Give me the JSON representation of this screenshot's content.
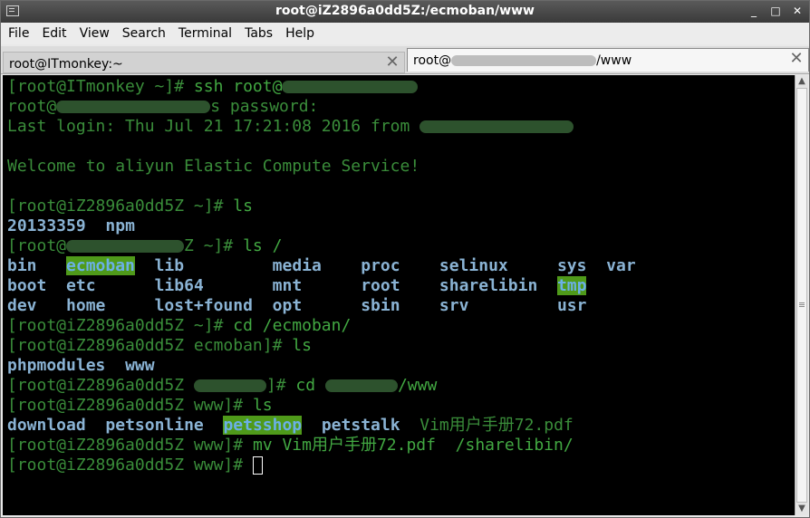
{
  "window": {
    "title": "root@iZ2896a0dd5Z:/ecmoban/www",
    "buttons": {
      "minimize": "_",
      "maximize": "□",
      "close": "✕"
    }
  },
  "menu": [
    "File",
    "Edit",
    "View",
    "Search",
    "Terminal",
    "Tabs",
    "Help"
  ],
  "tabs": [
    {
      "label": "root@ITmonkey:~",
      "close": "✕",
      "active": false
    },
    {
      "label_prefix": "root@",
      "label_suffix": "/www",
      "close": "✕",
      "active": true
    }
  ],
  "terminal": {
    "lines": {
      "l1_prompt": "[root@ITmonkey ~]# ",
      "l1_cmd": "ssh root@",
      "l2a": "root@",
      "l2b": "s password:",
      "l3": "Last login: Thu Jul 21 17:21:08 2016 from ",
      "l5": "Welcome to aliyun Elastic Compute Service!",
      "l7_prompt": "[root@iZ2896a0dd5Z ~]# ",
      "l7_cmd": "ls",
      "l8a": "20133359",
      "l8b": "npm",
      "l9a": "[root@",
      "l9b": "Z ~]# ",
      "l9_cmd": "ls /",
      "l13_prompt": "[root@iZ2896a0dd5Z ~]# ",
      "l13_cmd": "cd /ecmoban/",
      "l14_prompt": "[root@iZ2896a0dd5Z ecmoban]# ",
      "l14_cmd": "ls",
      "l15a": "phpmodules",
      "l15b": "www",
      "l16_prompt": "[root@iZ2896a0dd5Z ",
      "l16_mid": "]# ",
      "l16_cmd": "cd ",
      "l16_end": "/www",
      "l17_prompt": "[root@iZ2896a0dd5Z www]# ",
      "l17_cmd": "ls",
      "l19_prompt": "[root@iZ2896a0dd5Z www]# ",
      "l19_cmd": "mv Vim用户手册72.pdf  /sharelibin/",
      "l20_prompt": "[root@iZ2896a0dd5Z www]# "
    },
    "root_listing": [
      [
        "bin",
        "ecmoban",
        "lib",
        "media",
        "proc",
        "selinux",
        "sys",
        "var"
      ],
      [
        "boot",
        "etc",
        "lib64",
        "mnt",
        "root",
        "sharelibin",
        "tmp"
      ],
      [
        "dev",
        "home",
        "lost+found",
        "opt",
        "sbin",
        "srv",
        "usr"
      ]
    ],
    "www_listing": [
      "download",
      "petsonline",
      "petsshop",
      "petstalk",
      "Vim用户手册72.pdf"
    ]
  },
  "colors": {
    "background": "#000000",
    "text": "#3a8d3a",
    "directory": "#8ab3d4",
    "highlight": "#4f9a1a"
  }
}
